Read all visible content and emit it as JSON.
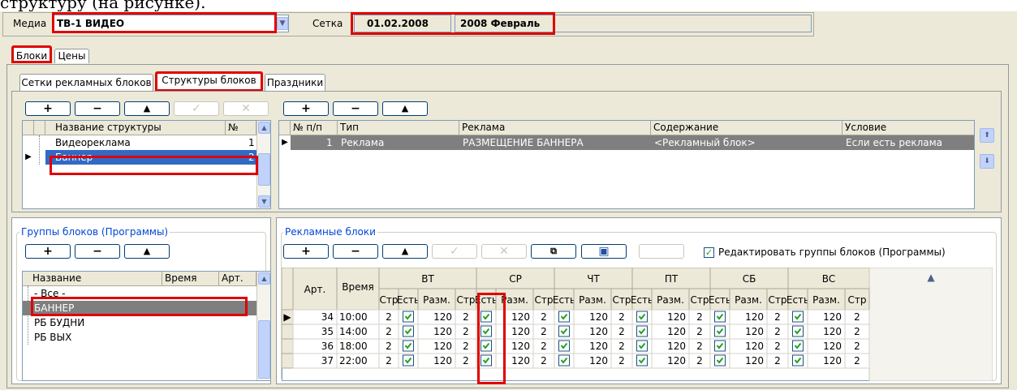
{
  "caption": "структуру (на рисунке).",
  "top": {
    "media_label": "Медиа",
    "media_value": "ТВ-1 ВИДЕО",
    "grid_label": "Сетка",
    "grid_date": "01.02.2008",
    "grid_month": "2008 Февраль"
  },
  "main_tabs": [
    "Блоки",
    "Цены"
  ],
  "sub_tabs": [
    "Сетки рекламных блоков",
    "Структуры блоков",
    "Праздники"
  ],
  "toolbar": {
    "add": "+",
    "remove": "−",
    "up": "▲",
    "check": "✓",
    "cancel": "✕"
  },
  "structures": {
    "headers": {
      "name": "Название структуры",
      "num": "№"
    },
    "rows": [
      {
        "name": "Видеореклама",
        "num": "1"
      },
      {
        "name": "Баннер",
        "num": "2"
      }
    ]
  },
  "items": {
    "headers": {
      "num": "№ п/п",
      "type": "Тип",
      "ad": "Реклама",
      "content": "Содержание",
      "condition": "Условие"
    },
    "rows": [
      {
        "num": "1",
        "type": "Реклама",
        "ad": "РАЗМЕЩЕНИЕ БАННЕРА",
        "content": "<Рекламный блок>",
        "condition": "Если есть реклама"
      }
    ]
  },
  "groups": {
    "title": "Группы блоков (Программы)",
    "headers": {
      "name": "Название",
      "time": "Время",
      "art": "Арт."
    },
    "rows": [
      "- Все -",
      "БАННЕР",
      "РБ БУДНИ",
      "РБ ВЫХ"
    ]
  },
  "blocks": {
    "title": "Рекламные блоки",
    "edit_groups_label": "Редактировать группы блоков (Программы)",
    "headers": {
      "art": "Арт.",
      "time": "Время",
      "str": "Стр",
      "est": "Есть",
      "size": "Разм."
    },
    "days": [
      "ВТ",
      "СР",
      "ЧТ",
      "ПТ",
      "СБ",
      "ВС"
    ],
    "rows": [
      {
        "art": "34",
        "time": "10:00",
        "str": "2",
        "size": "120"
      },
      {
        "art": "35",
        "time": "14:00",
        "str": "2",
        "size": "120"
      },
      {
        "art": "36",
        "time": "18:00",
        "str": "2",
        "size": "120"
      },
      {
        "art": "37",
        "time": "22:00",
        "str": "2",
        "size": "120"
      }
    ]
  },
  "colors": {
    "highlight": "#e00000",
    "selection_gray": "#7f7f7f",
    "selection_blue": "#316ac5",
    "group_title": "#0046d5"
  }
}
